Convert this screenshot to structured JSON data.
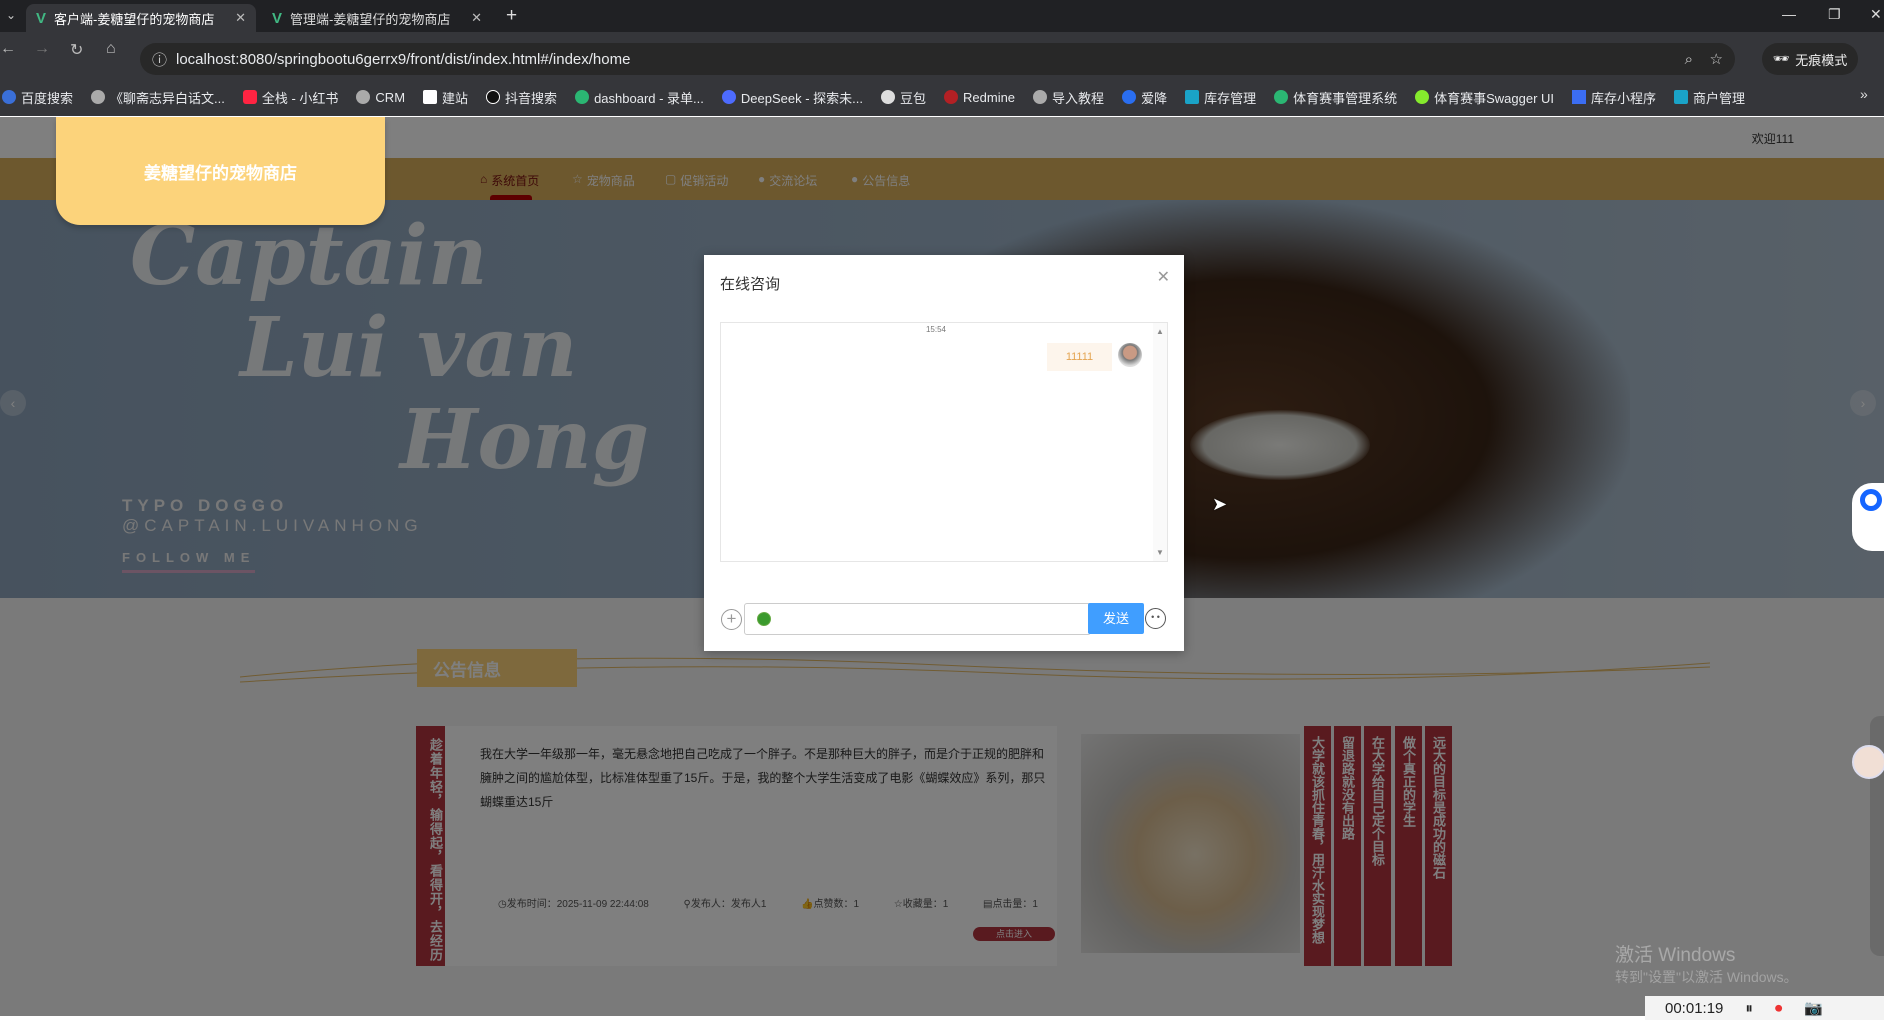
{
  "browser": {
    "tabs": [
      {
        "label": "客户端-姜糖望仔的宠物商店",
        "active": true
      },
      {
        "label": "管理端-姜糖望仔的宠物商店",
        "active": false
      }
    ],
    "url": "localhost:8080/springbootu6gerrx9/front/dist/index.html#/index/home",
    "incognito": "无痕模式",
    "bookmarks": [
      "百度搜索",
      "《聊斋志异白话文...",
      "全栈 - 小红书",
      "CRM",
      "建站",
      "抖音搜索",
      "dashboard - 录单...",
      "DeepSeek - 探索未...",
      "豆包",
      "Redmine",
      "导入教程",
      "爱降",
      "库存管理",
      "体育赛事管理系统",
      "体育赛事Swagger UI",
      "库存小程序",
      "商户管理"
    ]
  },
  "site": {
    "welcome": "欢迎111",
    "logo": "姜糖望仔的宠物商店",
    "nav": [
      {
        "icon": "⌂",
        "label": "系统首页"
      },
      {
        "icon": "☆",
        "label": "宠物商品"
      },
      {
        "icon": "▢",
        "label": "促销活动"
      },
      {
        "icon": "●",
        "label": "交流论坛"
      },
      {
        "icon": "●",
        "label": "公告信息"
      }
    ],
    "hero": {
      "script": [
        "Captain",
        "Lui van",
        "Hong"
      ],
      "line1": "TYPO DOGGO",
      "line2": "@CAPTAIN.LUIVANHONG",
      "follow": "FOLLOW ME"
    },
    "notice": {
      "heading": "公告信息",
      "side_title": "趁着年轻，输得起，看得开，去经历",
      "content": "我在大学一年级那一年，毫无悬念地把自己吃成了一个胖子。不是那种巨大的胖子，而是介于正规的肥胖和臃肿之间的尴尬体型，比标准体型重了15斤。于是，我的整个大学生活变成了电影《蝴蝶效应》系列，那只蝴蝶重达15斤",
      "meta": {
        "time": "发布时间：2025-11-09 22:44:08",
        "author": "发布人：发布人1",
        "likes": "点赞数：1",
        "favs": "收藏量：1",
        "clicks": "点击量：1"
      },
      "enter": "点击进入",
      "columns": [
        "大学就该抓住青春，用汗水实现梦想",
        "留退路就没有出路",
        "在大学给自己定个目标",
        "做个真正的学生",
        "远大的目标是成功的磁石"
      ]
    }
  },
  "chat": {
    "title": "在线咨询",
    "time": "15:54",
    "message": "11111",
    "send": "发送"
  },
  "os": {
    "watermark": "激活 Windows",
    "watermark_sub": "转到\"设置\"以激活 Windows。",
    "timer": "00:01:19"
  }
}
